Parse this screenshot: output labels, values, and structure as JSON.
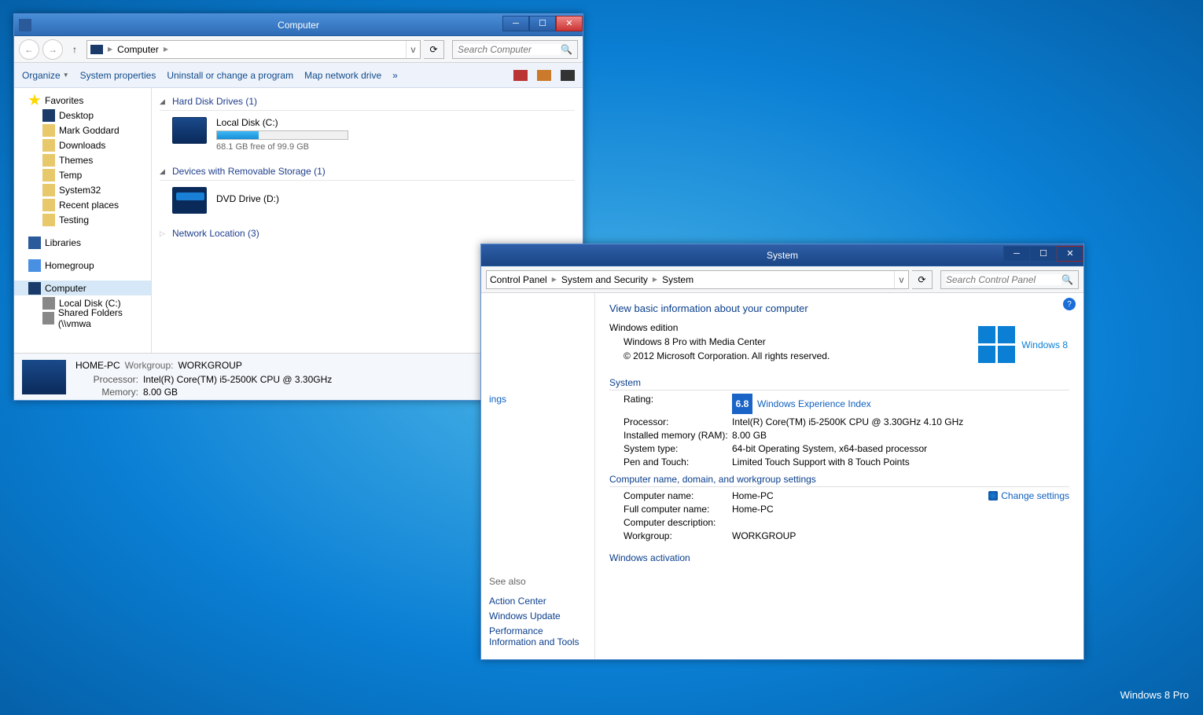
{
  "explorer": {
    "title": "Computer",
    "breadcrumb": "Computer",
    "search_placeholder": "Search Computer",
    "toolbar": {
      "organize": "Organize",
      "sysprops": "System properties",
      "uninstall": "Uninstall or change a program",
      "mapdrive": "Map network drive",
      "more": "»"
    },
    "nav": {
      "favorites": "Favorites",
      "desktop": "Desktop",
      "user": "Mark Goddard",
      "downloads": "Downloads",
      "themes": "Themes",
      "temp": "Temp",
      "system32": "System32",
      "recent": "Recent places",
      "testing": "Testing",
      "libraries": "Libraries",
      "homegroup": "Homegroup",
      "computer": "Computer",
      "localdisk": "Local Disk (C:)",
      "shared": "Shared Folders (\\\\vmwa"
    },
    "sections": {
      "hdd": "Hard Disk Drives (1)",
      "removable": "Devices with Removable Storage (1)",
      "network": "Network Location (3)"
    },
    "drives": {
      "c": {
        "name": "Local Disk (C:)",
        "free": "68.1 GB free of 99.9 GB",
        "pct": 32
      },
      "dvd": "DVD Drive (D:)"
    },
    "status": {
      "host": "HOME-PC",
      "wg_lbl": "Workgroup:",
      "wg": "WORKGROUP",
      "cpu_lbl": "Processor:",
      "cpu": "Intel(R) Core(TM) i5-2500K CPU @ 3.30GHz",
      "mem_lbl": "Memory:",
      "mem": "8.00 GB"
    }
  },
  "system": {
    "title": "System",
    "crumbs": {
      "c1": "Control Panel",
      "c2": "System and Security",
      "c3": "System"
    },
    "search_placeholder": "Search Control Panel",
    "main_hdr": "View basic information about your computer",
    "edition_hdr": "Windows edition",
    "edition": "Windows 8 Pro with Media Center",
    "copyright": "© 2012 Microsoft Corporation. All rights reserved.",
    "logo_text": "Windows 8",
    "sys_hdr": "System",
    "rating_lbl": "Rating:",
    "rating": "6.8",
    "wei": "Windows Experience Index",
    "cpu_lbl": "Processor:",
    "cpu": "Intel(R) Core(TM) i5-2500K CPU @ 3.30GHz   4.10 GHz",
    "ram_lbl": "Installed memory (RAM):",
    "ram": "8.00 GB",
    "systype_lbl": "System type:",
    "systype": "64-bit Operating System, x64-based processor",
    "pen_lbl": "Pen and Touch:",
    "pen": "Limited Touch Support with 8 Touch Points",
    "name_hdr": "Computer name, domain, and workgroup settings",
    "cname_lbl": "Computer name:",
    "cname": "Home-PC",
    "fname_lbl": "Full computer name:",
    "fname": "Home-PC",
    "desc_lbl": "Computer description:",
    "desc": "",
    "wg_lbl": "Workgroup:",
    "wg": "WORKGROUP",
    "change": "Change settings",
    "activation_hdr": "Windows activation",
    "side": {
      "seealso": "See also",
      "l1": "Action Center",
      "l2": "Windows Update",
      "l3": "Performance Information and Tools"
    },
    "truncated_link": "ings"
  },
  "watermark": "Windows 8 Pro"
}
